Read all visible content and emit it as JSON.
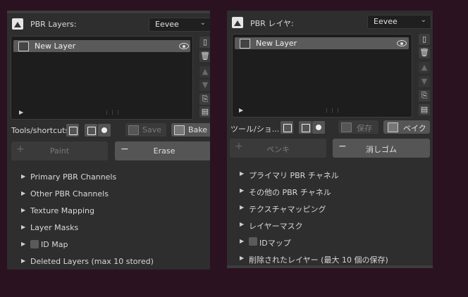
{
  "en": {
    "title": "PBR Layers:",
    "engine": "Eevee",
    "layer_name": "New Layer",
    "tools_label": "Tools/shortcuts:",
    "save": "Save",
    "bake": "Bake",
    "paint": "Paint",
    "erase": "Erase",
    "sections": [
      "Primary PBR Channels",
      "Other PBR Channels",
      "Texture Mapping",
      "Layer Masks",
      "ID Map",
      "Deleted Layers (max 10 stored)"
    ]
  },
  "ja": {
    "title": "PBR レイヤ:",
    "engine": "Eevee",
    "layer_name": "New Layer",
    "tools_label": "ツール/ショ...",
    "save": "保存",
    "bake": "ベイク",
    "paint": "ペンキ",
    "erase": "消しゴム",
    "sections": [
      "プライマリ PBR チャネル",
      "その他の PBR チャネル",
      "テクスチャマッピング",
      "レイヤーマスク",
      "IDマップ",
      "削除されたレイヤー (最大 10 個の保存)"
    ]
  },
  "icons": {
    "dropdown": "chevron-down-icon",
    "visibility": "eye-icon",
    "expand": "triangle-right-icon",
    "grip": "grip-dots-icon",
    "new": "new-layer-icon",
    "delete": "trash-icon",
    "up": "arrow-up-icon",
    "down": "arrow-down-icon",
    "paste": "paste-icon",
    "copy": "copy-icon"
  },
  "colors": {
    "background": "#2a1220",
    "panel": "#2e2e2e",
    "selected_row": "#5a5a5a",
    "button": "#555555"
  }
}
